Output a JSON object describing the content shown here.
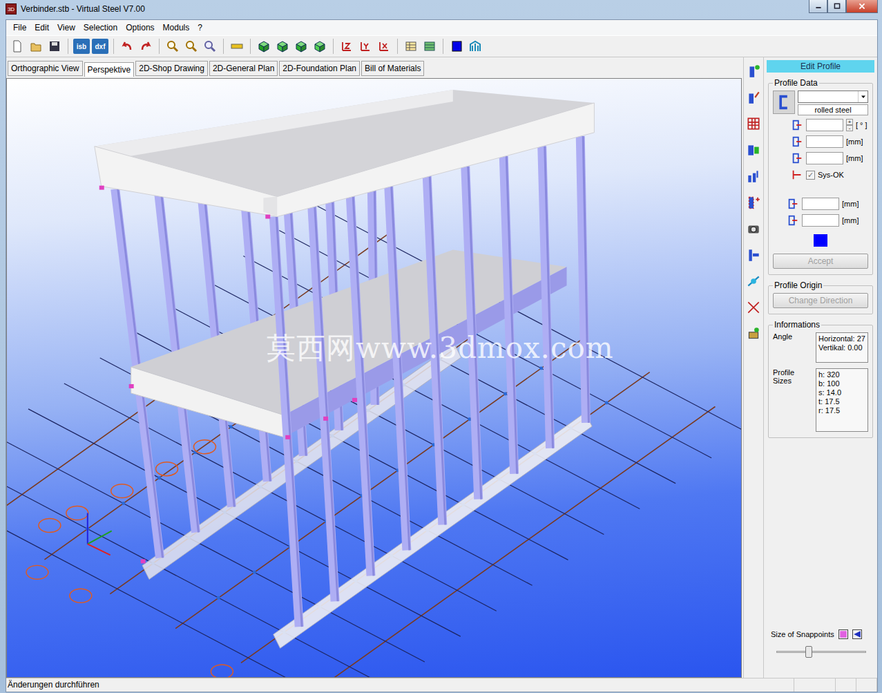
{
  "window": {
    "title": "Verbinder.stb - Virtual Steel V7.00",
    "app_icon": "3D"
  },
  "menu": [
    "File",
    "Edit",
    "View",
    "Selection",
    "Options",
    "Moduls",
    "?"
  ],
  "toolbar": {
    "text_buttons": [
      "isb",
      "dxf"
    ]
  },
  "tabs": [
    {
      "label": "Orthographic View",
      "selected": false
    },
    {
      "label": "Perspektive",
      "selected": true
    },
    {
      "label": "2D-Shop Drawing",
      "selected": false
    },
    {
      "label": "2D-General Plan",
      "selected": false
    },
    {
      "label": "2D-Foundation Plan",
      "selected": false
    },
    {
      "label": "Bill of Materials",
      "selected": false
    }
  ],
  "watermark": "莫西网www.3dmox.com",
  "panel": {
    "header": "Edit Profile",
    "profile_data": {
      "title": "Profile Data",
      "dropdown_value": "",
      "material": "rolled steel",
      "angle": {
        "value": "",
        "unit": "[ ° ]",
        "spin_up": "+",
        "spin_down": "-"
      },
      "dims": [
        {
          "value": "",
          "unit": "[mm]"
        },
        {
          "value": "",
          "unit": "[mm]"
        }
      ],
      "sys_ok": {
        "label": "Sys-OK",
        "checked": true
      },
      "offsets": [
        {
          "value": "",
          "unit": "[mm]"
        },
        {
          "value": "",
          "unit": "[mm]"
        }
      ],
      "profile_color": "#0000ff",
      "accept": {
        "label": "Accept",
        "disabled": true
      }
    },
    "profile_origin": {
      "title": "Profile Origin",
      "button": {
        "label": "Change Direction",
        "disabled": true
      }
    },
    "informations": {
      "title": "Informations",
      "angle": {
        "label": "Angle",
        "lines": [
          "Horizontal: 27",
          "Vertikal: 0.00"
        ]
      },
      "sizes": {
        "label": "Profile Sizes",
        "lines": [
          "h: 320",
          "b: 100",
          "s: 14.0",
          "t: 17.5",
          "r: 17.5"
        ]
      }
    },
    "snappoints": {
      "label": "Size of Snappoints",
      "level": 0.36
    }
  },
  "status_bar": {
    "text": "Änderungen durchführen"
  }
}
